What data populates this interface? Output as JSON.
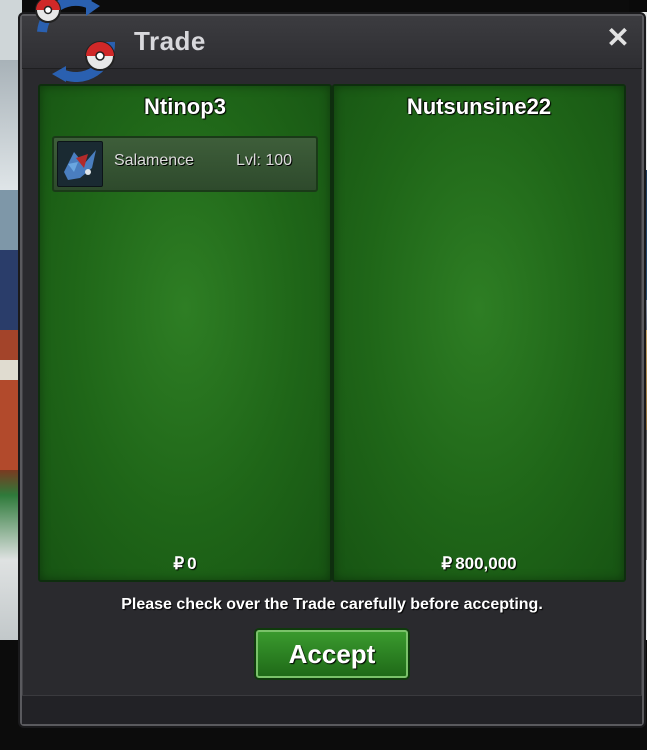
{
  "window": {
    "title": "Trade",
    "close_symbol": "✕"
  },
  "left_panel": {
    "player": "Ntinop3",
    "pokemon": [
      {
        "name": "Salamence",
        "level": "Lvl: 100",
        "icon": "salamence-sprite-icon"
      }
    ],
    "currency_symbol": "₽",
    "money": "0"
  },
  "right_panel": {
    "player": "Nutsunsine22",
    "pokemon": [],
    "currency_symbol": "₽",
    "money": "800,000"
  },
  "notice": "Please check over the Trade carefully before accepting.",
  "accept_label": "Accept",
  "colors": {
    "panel_green": "#1f6618",
    "accept_green": "#2e8a24",
    "dialog_bg": "#2a2a2e"
  }
}
